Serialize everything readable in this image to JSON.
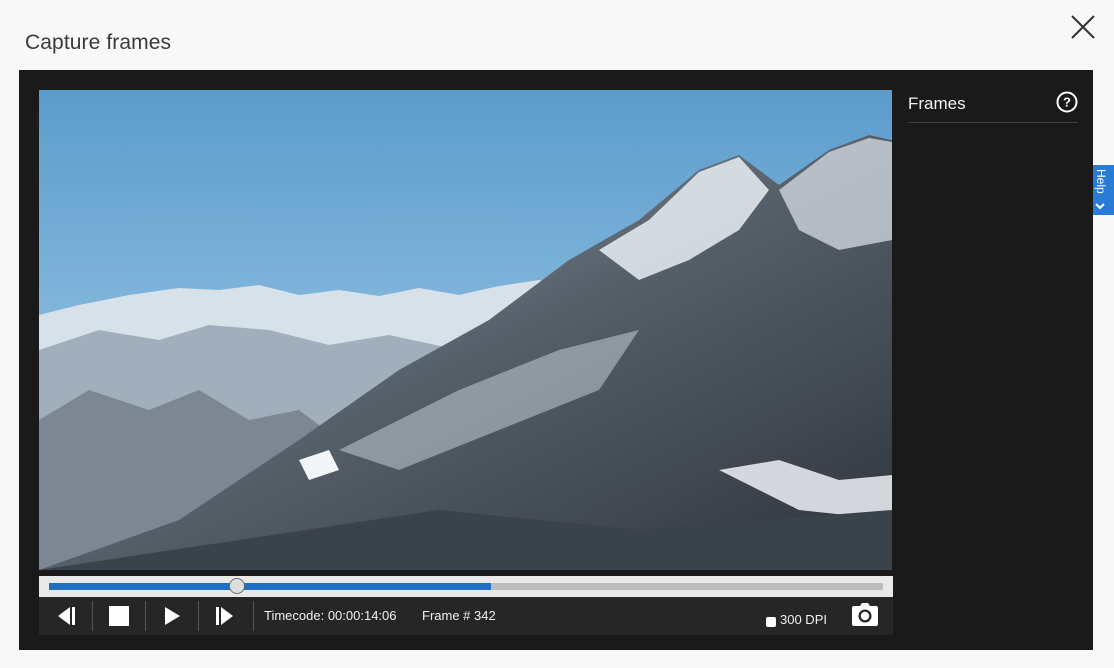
{
  "dialog": {
    "title": "Capture frames",
    "close_icon": "close-icon"
  },
  "help_tab": {
    "label": "Help",
    "icon": "chevron-down-icon",
    "color": "#2a7bd6"
  },
  "player": {
    "progress": 0.53,
    "thumb_position": 0.225,
    "controls": {
      "prev_frame_icon": "step-back-icon",
      "stop_icon": "stop-icon",
      "play_icon": "play-icon",
      "next_frame_icon": "step-forward-icon"
    },
    "timecode": "Timecode: 00:00:14:06",
    "frame": "Frame # 342",
    "dpi_label": "300 DPI",
    "dpi_checked": false,
    "capture_icon": "camera-icon",
    "accent": "#1f6fc4"
  },
  "frames_pane": {
    "title": "Frames",
    "help_icon": "question-circle-icon"
  }
}
